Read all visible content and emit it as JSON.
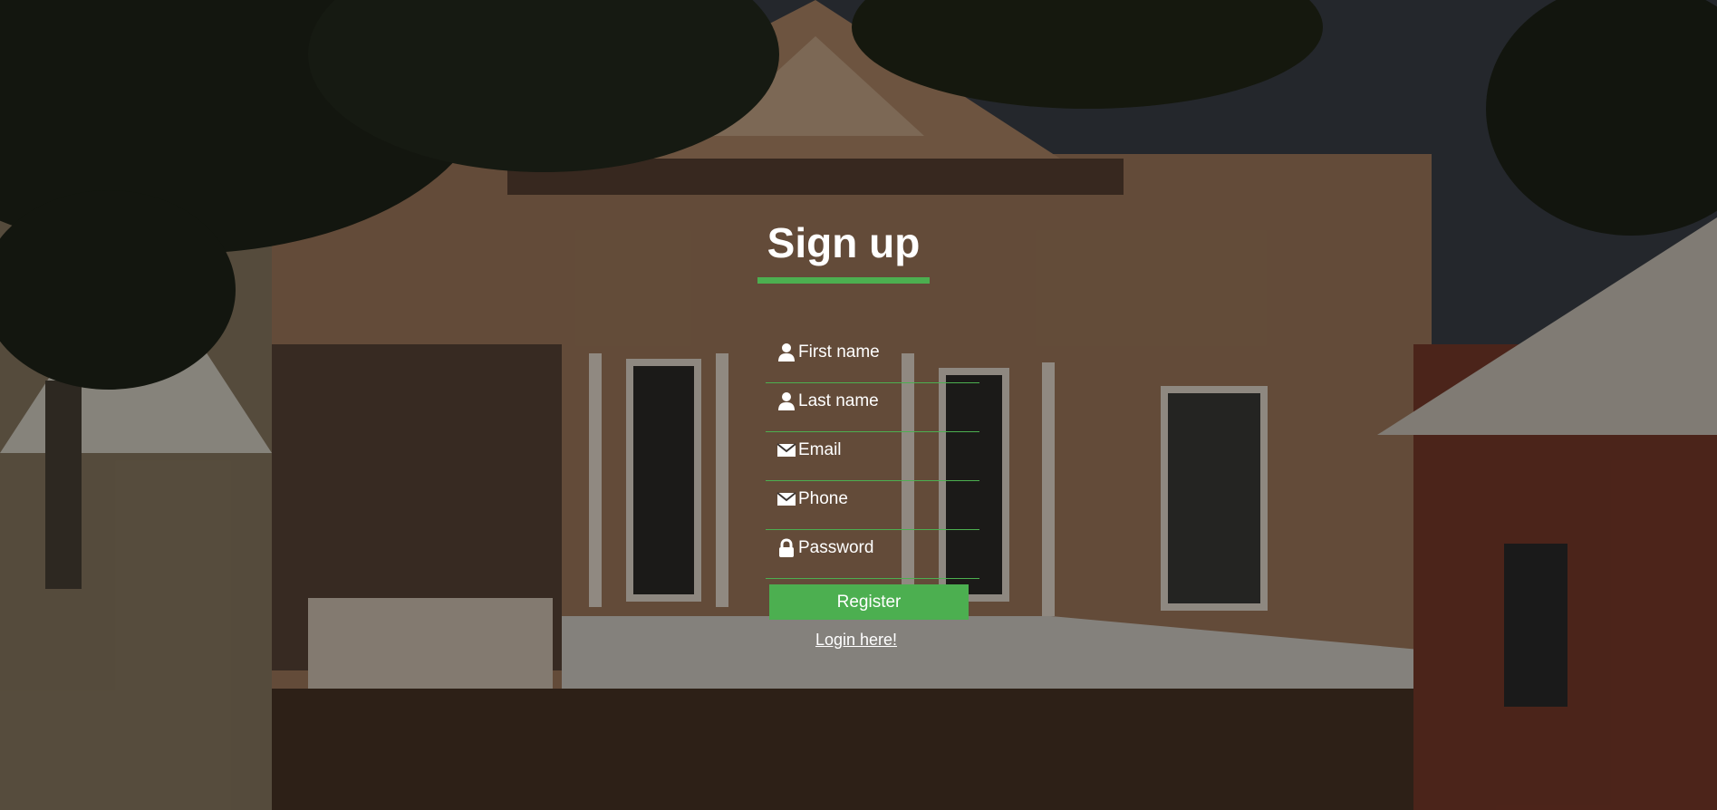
{
  "page": {
    "title": "Sign up",
    "accent_color": "#4caf50",
    "background": "house-photo"
  },
  "form": {
    "fields": [
      {
        "icon": "user-icon",
        "placeholder": "First name",
        "value": ""
      },
      {
        "icon": "user-icon",
        "placeholder": "Last name",
        "value": ""
      },
      {
        "icon": "envelope-icon",
        "placeholder": "Email",
        "value": ""
      },
      {
        "icon": "envelope-icon",
        "placeholder": "Phone",
        "value": ""
      },
      {
        "icon": "lock-icon",
        "placeholder": "Password",
        "value": ""
      }
    ],
    "register_label": "Register",
    "login_link_label": "Login here!"
  }
}
